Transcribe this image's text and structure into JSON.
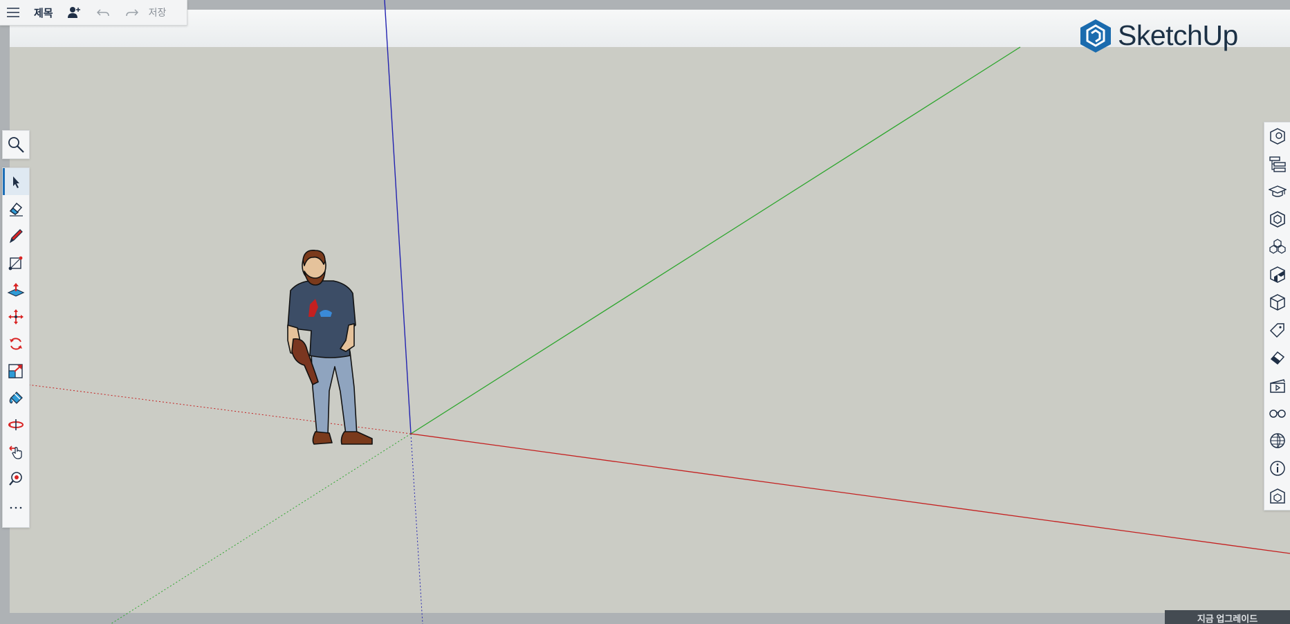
{
  "app": {
    "logo_text": "SketchUp"
  },
  "topbar": {
    "title": "제목",
    "save_label": "저장"
  },
  "left_tools": [
    {
      "name": "select-tool",
      "icon": "arrow-icon"
    },
    {
      "name": "eraser-tool",
      "icon": "eraser-icon"
    },
    {
      "name": "pencil-tool",
      "icon": "pencil-icon"
    },
    {
      "name": "rectangle-tool",
      "icon": "rectangle-icon"
    },
    {
      "name": "push-pull-tool",
      "icon": "push-pull-icon"
    },
    {
      "name": "move-tool",
      "icon": "move-icon"
    },
    {
      "name": "rotate-tool",
      "icon": "rotate-icon"
    },
    {
      "name": "scale-tool",
      "icon": "scale-icon"
    },
    {
      "name": "paint-tool",
      "icon": "paint-bucket-icon"
    },
    {
      "name": "orbit-tool",
      "icon": "orbit-icon"
    },
    {
      "name": "pan-tool",
      "icon": "pan-hand-icon"
    },
    {
      "name": "zoom-window-tool",
      "icon": "zoom-window-icon"
    },
    {
      "name": "more-tools",
      "icon": "ellipsis-icon"
    }
  ],
  "upgrade": {
    "label": "지금 업그레이드"
  },
  "colors": {
    "axis_blue": "#1f1fb8",
    "axis_green": "#2da62d",
    "axis_red": "#c41f1f",
    "viewport": "#cbccc5",
    "brand": "#1a6bae"
  }
}
